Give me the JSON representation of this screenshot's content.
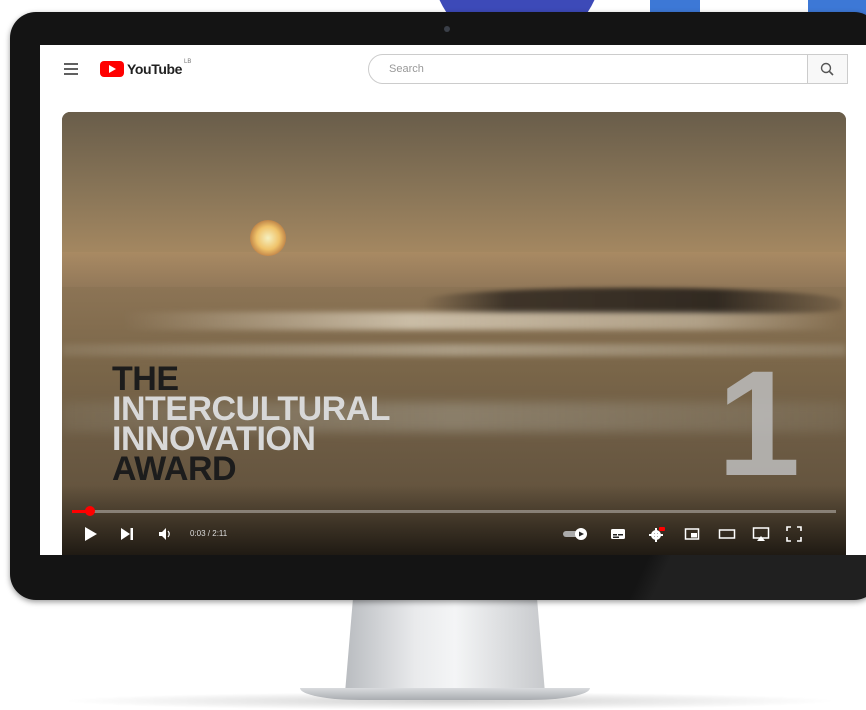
{
  "header": {
    "logo_text": "YouTube",
    "logo_suffix": "LB",
    "search_placeholder": "Search"
  },
  "video": {
    "title_lines": [
      "THE",
      "INTERCULTURAL",
      "INNOVATION",
      "AWARD"
    ],
    "overlay_number": "1",
    "time_display": "0:03 / 2:11",
    "progress_fraction": 0.023
  },
  "controls": {
    "icons": [
      "play-icon",
      "next-icon",
      "volume-icon",
      "autoplay-toggle-icon",
      "subtitles-icon",
      "settings-icon",
      "miniplayer-icon",
      "theater-mode-icon",
      "cast-icon",
      "fullscreen-icon"
    ]
  },
  "colors": {
    "brand_red": "#ff0000",
    "monitor_bezel": "#141414"
  }
}
